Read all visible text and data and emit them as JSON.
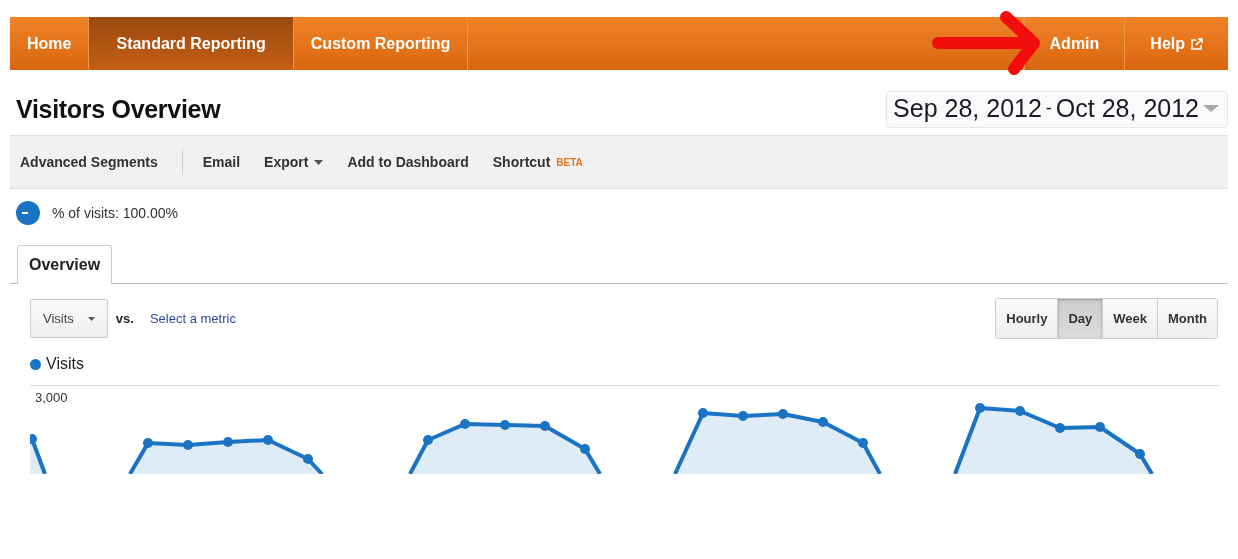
{
  "nav": {
    "tabs": [
      {
        "label": "Home",
        "selected": false
      },
      {
        "label": "Standard Reporting",
        "selected": true
      },
      {
        "label": "Custom Reporting",
        "selected": false
      }
    ],
    "right": [
      {
        "label": "Admin",
        "kind": "plain"
      },
      {
        "label": "Help",
        "kind": "external"
      }
    ]
  },
  "page_title": "Visitors Overview",
  "date_range": {
    "start": "Sep 28, 2012",
    "separator": "-",
    "end": "Oct 28, 2012"
  },
  "toolbar": [
    {
      "label": "Advanced Segments",
      "kind": "segments"
    },
    {
      "label": "Email",
      "kind": "plain"
    },
    {
      "label": "Export",
      "kind": "menu"
    },
    {
      "label": "Add to Dashboard",
      "kind": "plain"
    },
    {
      "label": "Shortcut",
      "kind": "badge",
      "badge": "BETA"
    }
  ],
  "segment": {
    "label": "% of visits: 100.00%"
  },
  "report_tabs": [
    {
      "label": "Overview",
      "selected": true
    }
  ],
  "metric": {
    "value": "Visits",
    "vs": "vs.",
    "link": "Select a metric"
  },
  "intervals": [
    {
      "label": "Hourly",
      "selected": false
    },
    {
      "label": "Day",
      "selected": true
    },
    {
      "label": "Week",
      "selected": false
    },
    {
      "label": "Month",
      "selected": false
    }
  ],
  "chart": {
    "legend": "Visits",
    "axis_label": "3,000"
  }
}
